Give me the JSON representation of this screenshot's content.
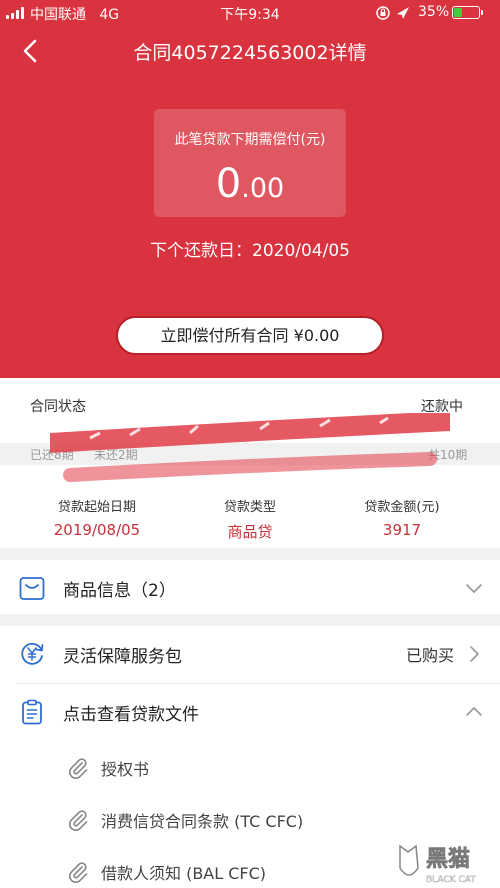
{
  "status_bar": {
    "carrier": "中国联通",
    "network": "4G",
    "time": "下午9:34",
    "battery": "35%",
    "battery_level": 0.35
  },
  "nav": {
    "title": "合同4057224563002详情"
  },
  "due": {
    "label": "此笔贷款下期需偿付(元)",
    "amount_int": "0",
    "amount_dec": ".00",
    "next_date": "下个还款日：2020/04/05",
    "pay_all_label": "立即偿付所有合同 ¥0.00"
  },
  "contract_status": {
    "label": "合同状态",
    "state": "还款中",
    "paid": "已还8期",
    "remaining": "未还2期",
    "total": "共10期"
  },
  "loan_info": {
    "start_label": "贷款起始日期",
    "start_value": "2019/08/05",
    "type_label": "贷款类型",
    "type_value": "商品贷",
    "amount_label": "贷款金额(元)",
    "amount_value": "3917"
  },
  "menu": {
    "goods": "商品信息（2）",
    "service": "灵活保障服务包",
    "service_status": "已购买",
    "documents": "点击查看贷款文件"
  },
  "documents": [
    {
      "label": "授权书"
    },
    {
      "label": "消费信贷合同条款 (TC CFC)"
    },
    {
      "label": "借款人须知 (BAL CFC)"
    }
  ],
  "watermark": {
    "text": "黑猫",
    "sub": "BLACK CAT"
  },
  "colors": {
    "brand_red": "#d8333e",
    "value_red": "#c9313a",
    "battery_green": "#3dd23d"
  }
}
